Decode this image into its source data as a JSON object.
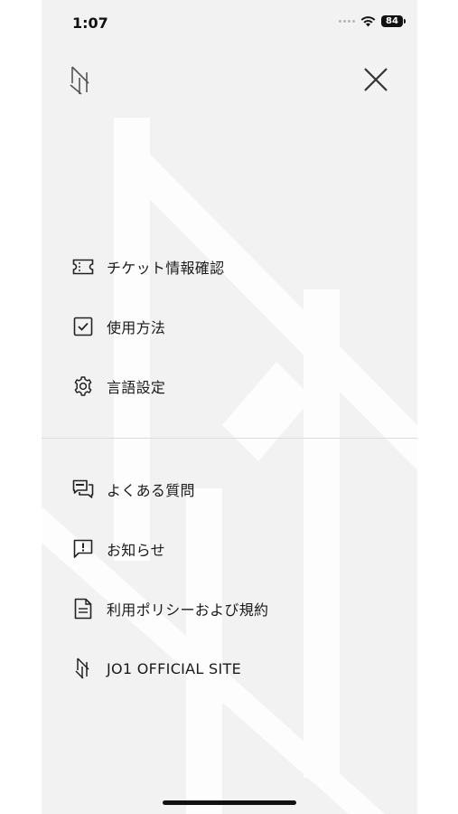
{
  "status_bar": {
    "time": "1:07",
    "battery": "84",
    "icons": [
      "signal-icon",
      "wifi-icon",
      "battery-icon"
    ]
  },
  "header": {
    "logo_icon": "jo1-logo-icon",
    "close_icon": "close-icon"
  },
  "menu_primary": [
    {
      "label": "チケット情報確認",
      "icon": "ticket-icon"
    },
    {
      "label": "使用方法",
      "icon": "checkbox-icon"
    },
    {
      "label": "言語設定",
      "icon": "gear-icon"
    }
  ],
  "menu_secondary": [
    {
      "label": "よくある質問",
      "icon": "chat-bubbles-icon"
    },
    {
      "label": "お知らせ",
      "icon": "alert-message-icon"
    },
    {
      "label": "利用ポリシーおよび規約",
      "icon": "document-icon"
    },
    {
      "label": "JO1 OFFICIAL SITE",
      "icon": "jo1-logo-icon"
    }
  ],
  "colors": {
    "background": "#f2f2f2",
    "text": "#1a1a1a",
    "divider": "#dcdcdc",
    "watermark": "#ffffff"
  }
}
